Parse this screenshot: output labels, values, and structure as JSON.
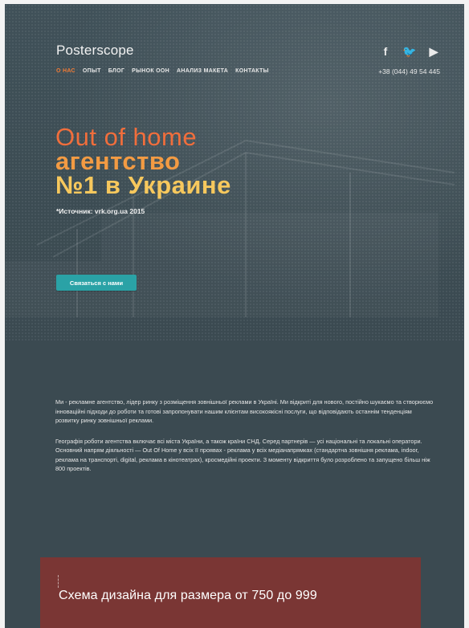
{
  "brand": {
    "logo": "Posterscope"
  },
  "nav": {
    "items": [
      {
        "label": "О НАС",
        "active": true
      },
      {
        "label": "ОПЫТ"
      },
      {
        "label": "БЛОГ"
      },
      {
        "label": "РЫНОК ООН"
      },
      {
        "label": "АНАЛИЗ МАКЕТА"
      },
      {
        "label": "КОНТАКТЫ"
      }
    ],
    "phone": "+38 (044) 49 54 445"
  },
  "social": {
    "icons": [
      "facebook-icon",
      "twitter-icon",
      "youtube-icon"
    ],
    "glyphs": [
      "f",
      "🐦",
      "▶"
    ]
  },
  "hero": {
    "line1": "Out of home",
    "line2": "агентство",
    "line3": "№1 в Украине",
    "source": "*Источник: vrk.org.ua 2015",
    "cta": "Связаться с нами"
  },
  "content": {
    "paragraph1": "Ми - рекламне агентство, лідер ринку з розміщення зовнішньої реклами в Україні. Ми відкриті для нового, постійно шукаємо та створюємо інноваційні підходи до роботи та готові запропонувати нашим клієнтам високоякісні послуги, що відповідають останнім тенденціям розвитку ринку зовнішньої реклами.",
    "paragraph2": "Географія роботи агентства включає всі міста України, а також країни СНД. Серед партнерів — усі національні та локальні оператори. Основний напрям діяльності — Out Of Home у всіх її проявах - реклама у всіх медіанапрямках (стандартна зовнішня реклама, indoor, реклама на транспорті, digital, реклама в кінотеатрах), кросмедійні проекти. З моменту відкриття було розроблено та запущено більш ніж 800 проектів."
  },
  "note": {
    "text": "Схема дизайна для размера от 750 до 999"
  },
  "colors": {
    "background": "#3b4a51",
    "accent_orange": "#f16e3c",
    "accent_amber": "#f39b43",
    "accent_yellow": "#f7c85d",
    "button_teal": "#2aa2a6",
    "note_red": "#7a3634"
  }
}
